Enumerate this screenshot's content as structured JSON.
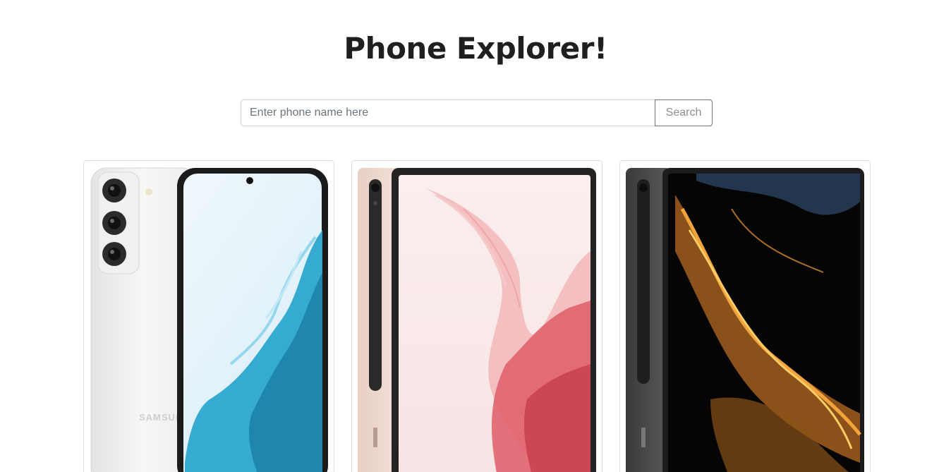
{
  "page": {
    "title": "Phone Explorer!"
  },
  "search": {
    "placeholder": "Enter phone name here",
    "value": "",
    "button_label": "Search"
  },
  "phones": [
    {
      "image": "samsung-galaxy-s22-white",
      "brand_text": "SAMSUNG",
      "accent": "#2ca7cf"
    },
    {
      "image": "samsung-galaxy-tab-s8-pink-gold",
      "accent": "#e0636e"
    },
    {
      "image": "samsung-galaxy-tab-s8-ultra-graphite",
      "accent": "#e39a3a"
    }
  ]
}
